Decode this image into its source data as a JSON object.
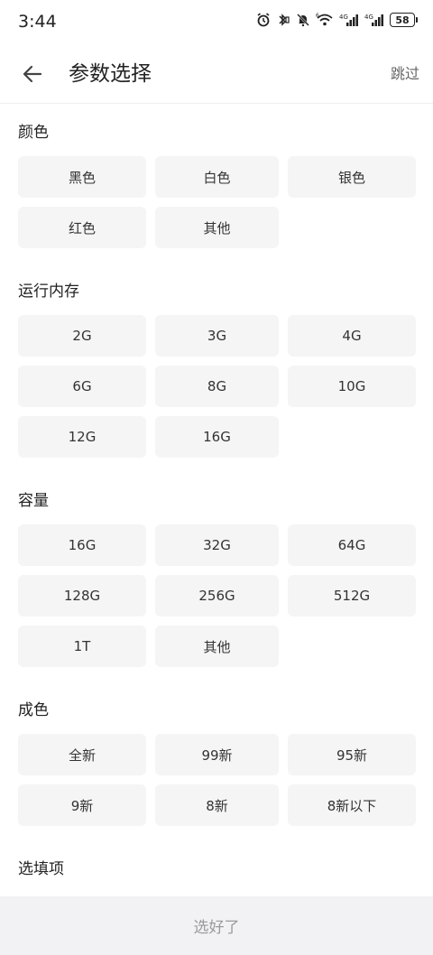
{
  "status_bar": {
    "time": "3:44",
    "battery": "58",
    "network_1": "4G",
    "network_2": "4G",
    "wifi_badge": "6"
  },
  "header": {
    "title": "参数选择",
    "skip_label": "跳过"
  },
  "sections": [
    {
      "title": "颜色",
      "options": [
        "黑色",
        "白色",
        "银色",
        "红色",
        "其他"
      ]
    },
    {
      "title": "运行内存",
      "options": [
        "2G",
        "3G",
        "4G",
        "6G",
        "8G",
        "10G",
        "12G",
        "16G"
      ]
    },
    {
      "title": "容量",
      "options": [
        "16G",
        "32G",
        "64G",
        "128G",
        "256G",
        "512G",
        "1T",
        "其他"
      ]
    },
    {
      "title": "成色",
      "options": [
        "全新",
        "99新",
        "95新",
        "9新",
        "8新",
        "8新以下"
      ]
    },
    {
      "title": "选填项",
      "options": []
    }
  ],
  "footer": {
    "confirm_label": "选好了"
  },
  "colors": {
    "chip_bg": "#f5f5f5",
    "footer_bg": "#f2f2f4",
    "confirm_text": "#9a9a9a"
  }
}
